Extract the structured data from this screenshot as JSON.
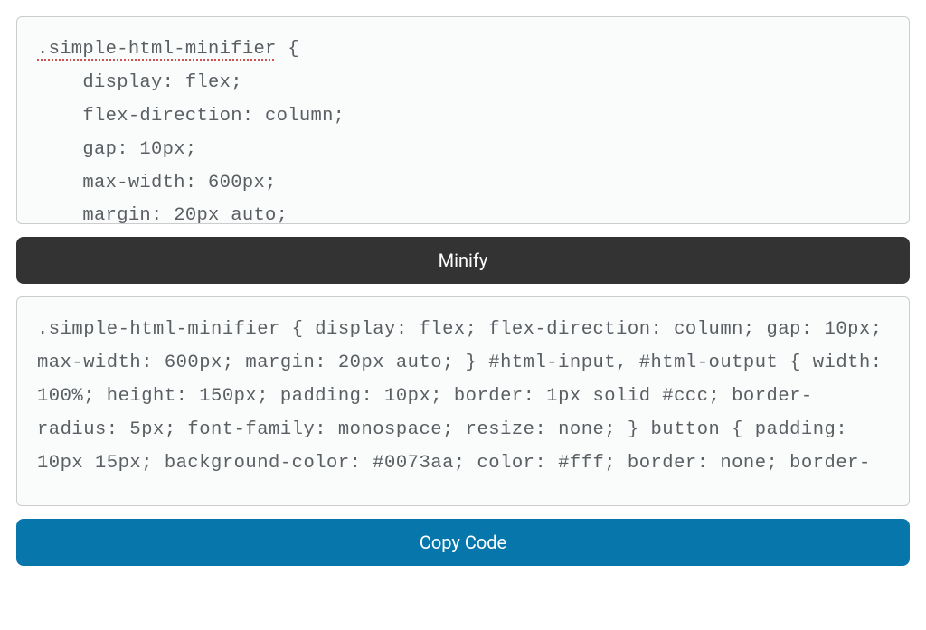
{
  "input": {
    "line1_selector": ".simple-html-minifier",
    "line1_brace": " {",
    "rest": "    display: flex;\n    flex-direction: column;\n    gap: 10px;\n    max-width: 600px;\n    margin: 20px auto;"
  },
  "buttons": {
    "minify": "Minify",
    "copy": "Copy Code"
  },
  "output": {
    "text": ".simple-html-minifier { display: flex; flex-direction: column; gap: 10px; max-width: 600px; margin: 20px auto; } #html-input, #html-output { width: 100%; height: 150px; padding: 10px; border: 1px solid #ccc; border-radius: 5px; font-family: monospace; resize: none; } button { padding: 10px 15px; background-color: #0073aa; color: #fff; border: none; border-"
  }
}
